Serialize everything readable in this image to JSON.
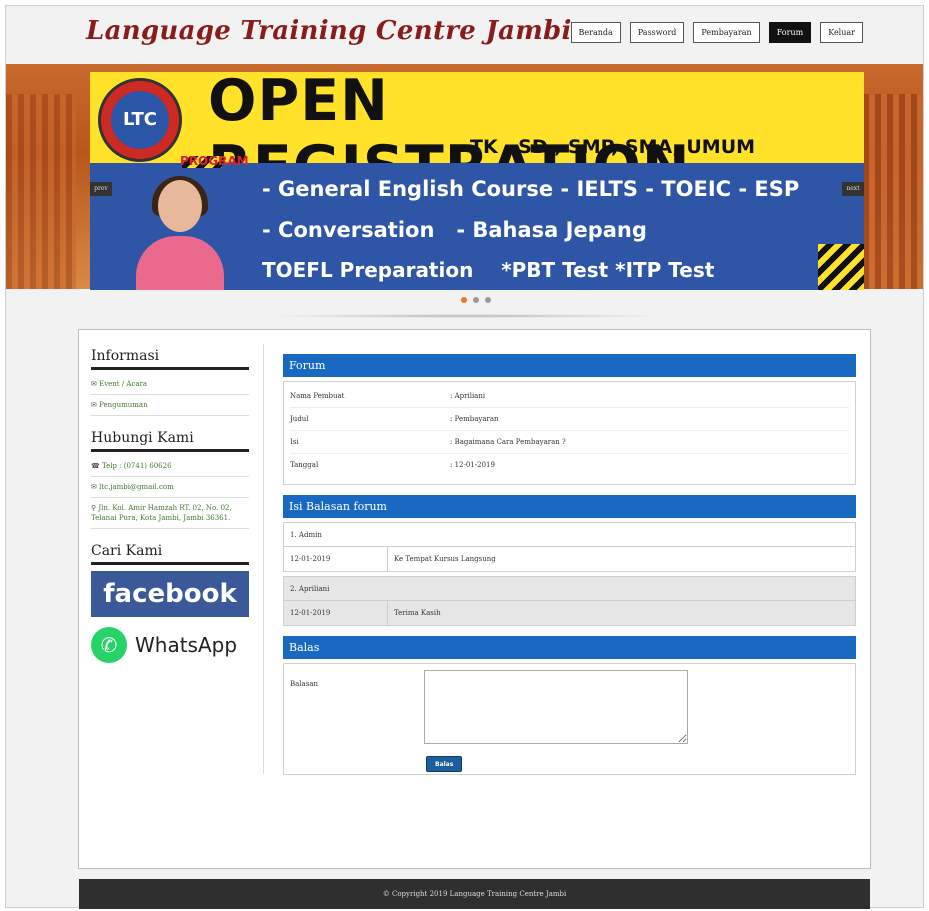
{
  "header": {
    "site_title": "Language Training Centre Jambi",
    "nav": [
      {
        "label": "Beranda",
        "active": false
      },
      {
        "label": "Password",
        "active": false
      },
      {
        "label": "Pembayaran",
        "active": false
      },
      {
        "label": "Forum",
        "active": true
      },
      {
        "label": "Keluar",
        "active": false
      }
    ]
  },
  "banner": {
    "headline": "OPEN REGISTRATION",
    "levels": "TK , SD , SMP, SMA, UMUM",
    "program_label": "PROGRAM",
    "line1": "- General English Course   - IELTS - TOEIC - ESP",
    "line2a": "- Conversation",
    "line2b": "- Bahasa Jepang",
    "line3a": "TOEFL Preparation",
    "line3b": "*PBT Test *ITP Test",
    "prev": "prev",
    "next": "next"
  },
  "sidebar": {
    "info_title": "Informasi",
    "info_links": [
      "Event / Acara",
      "Pengumuman"
    ],
    "contact_title": "Hubungi Kami",
    "phone": "Telp : (0741) 60626",
    "email": "ltc.jambi@gmail.com",
    "address": "Jln. Kol. Amir Hamzah RT. 02, No. 02, Telanai Pura, Kota Jambi, Jambi 36361.",
    "find_title": "Cari Kami",
    "facebook": "facebook",
    "whatsapp": "WhatsApp"
  },
  "forum": {
    "section_title": "Forum",
    "fields": [
      {
        "label": "Nama Pembuat",
        "value": ": Apriliani"
      },
      {
        "label": "Judul",
        "value": ": Pembayaran"
      },
      {
        "label": "Isi",
        "value": ": Bagaimana Cara Pembayaran ?"
      },
      {
        "label": "Tanggal",
        "value": ": 12-01-2019"
      }
    ]
  },
  "replies": {
    "section_title": "Isi Balasan forum",
    "items": [
      {
        "author": "1. Admin",
        "date": "12-01-2019",
        "message": "Ke Tempat Kursus Langsung"
      },
      {
        "author": "2. Apriliani",
        "date": "12-01-2019",
        "message": "Terima Kasih"
      }
    ]
  },
  "reply_form": {
    "section_title": "Balas",
    "label": "Balasan",
    "textarea_value": "",
    "submit_label": "Balas"
  },
  "footer": {
    "text": "© Copyright 2019 Language Training Centre Jambi"
  },
  "colors": {
    "accent_blue": "#1969c2",
    "title_red": "#8a1c1c",
    "banner_yellow": "#ffe229",
    "banner_blue": "#2f56a6",
    "footer_dark": "#2f2f2f"
  }
}
